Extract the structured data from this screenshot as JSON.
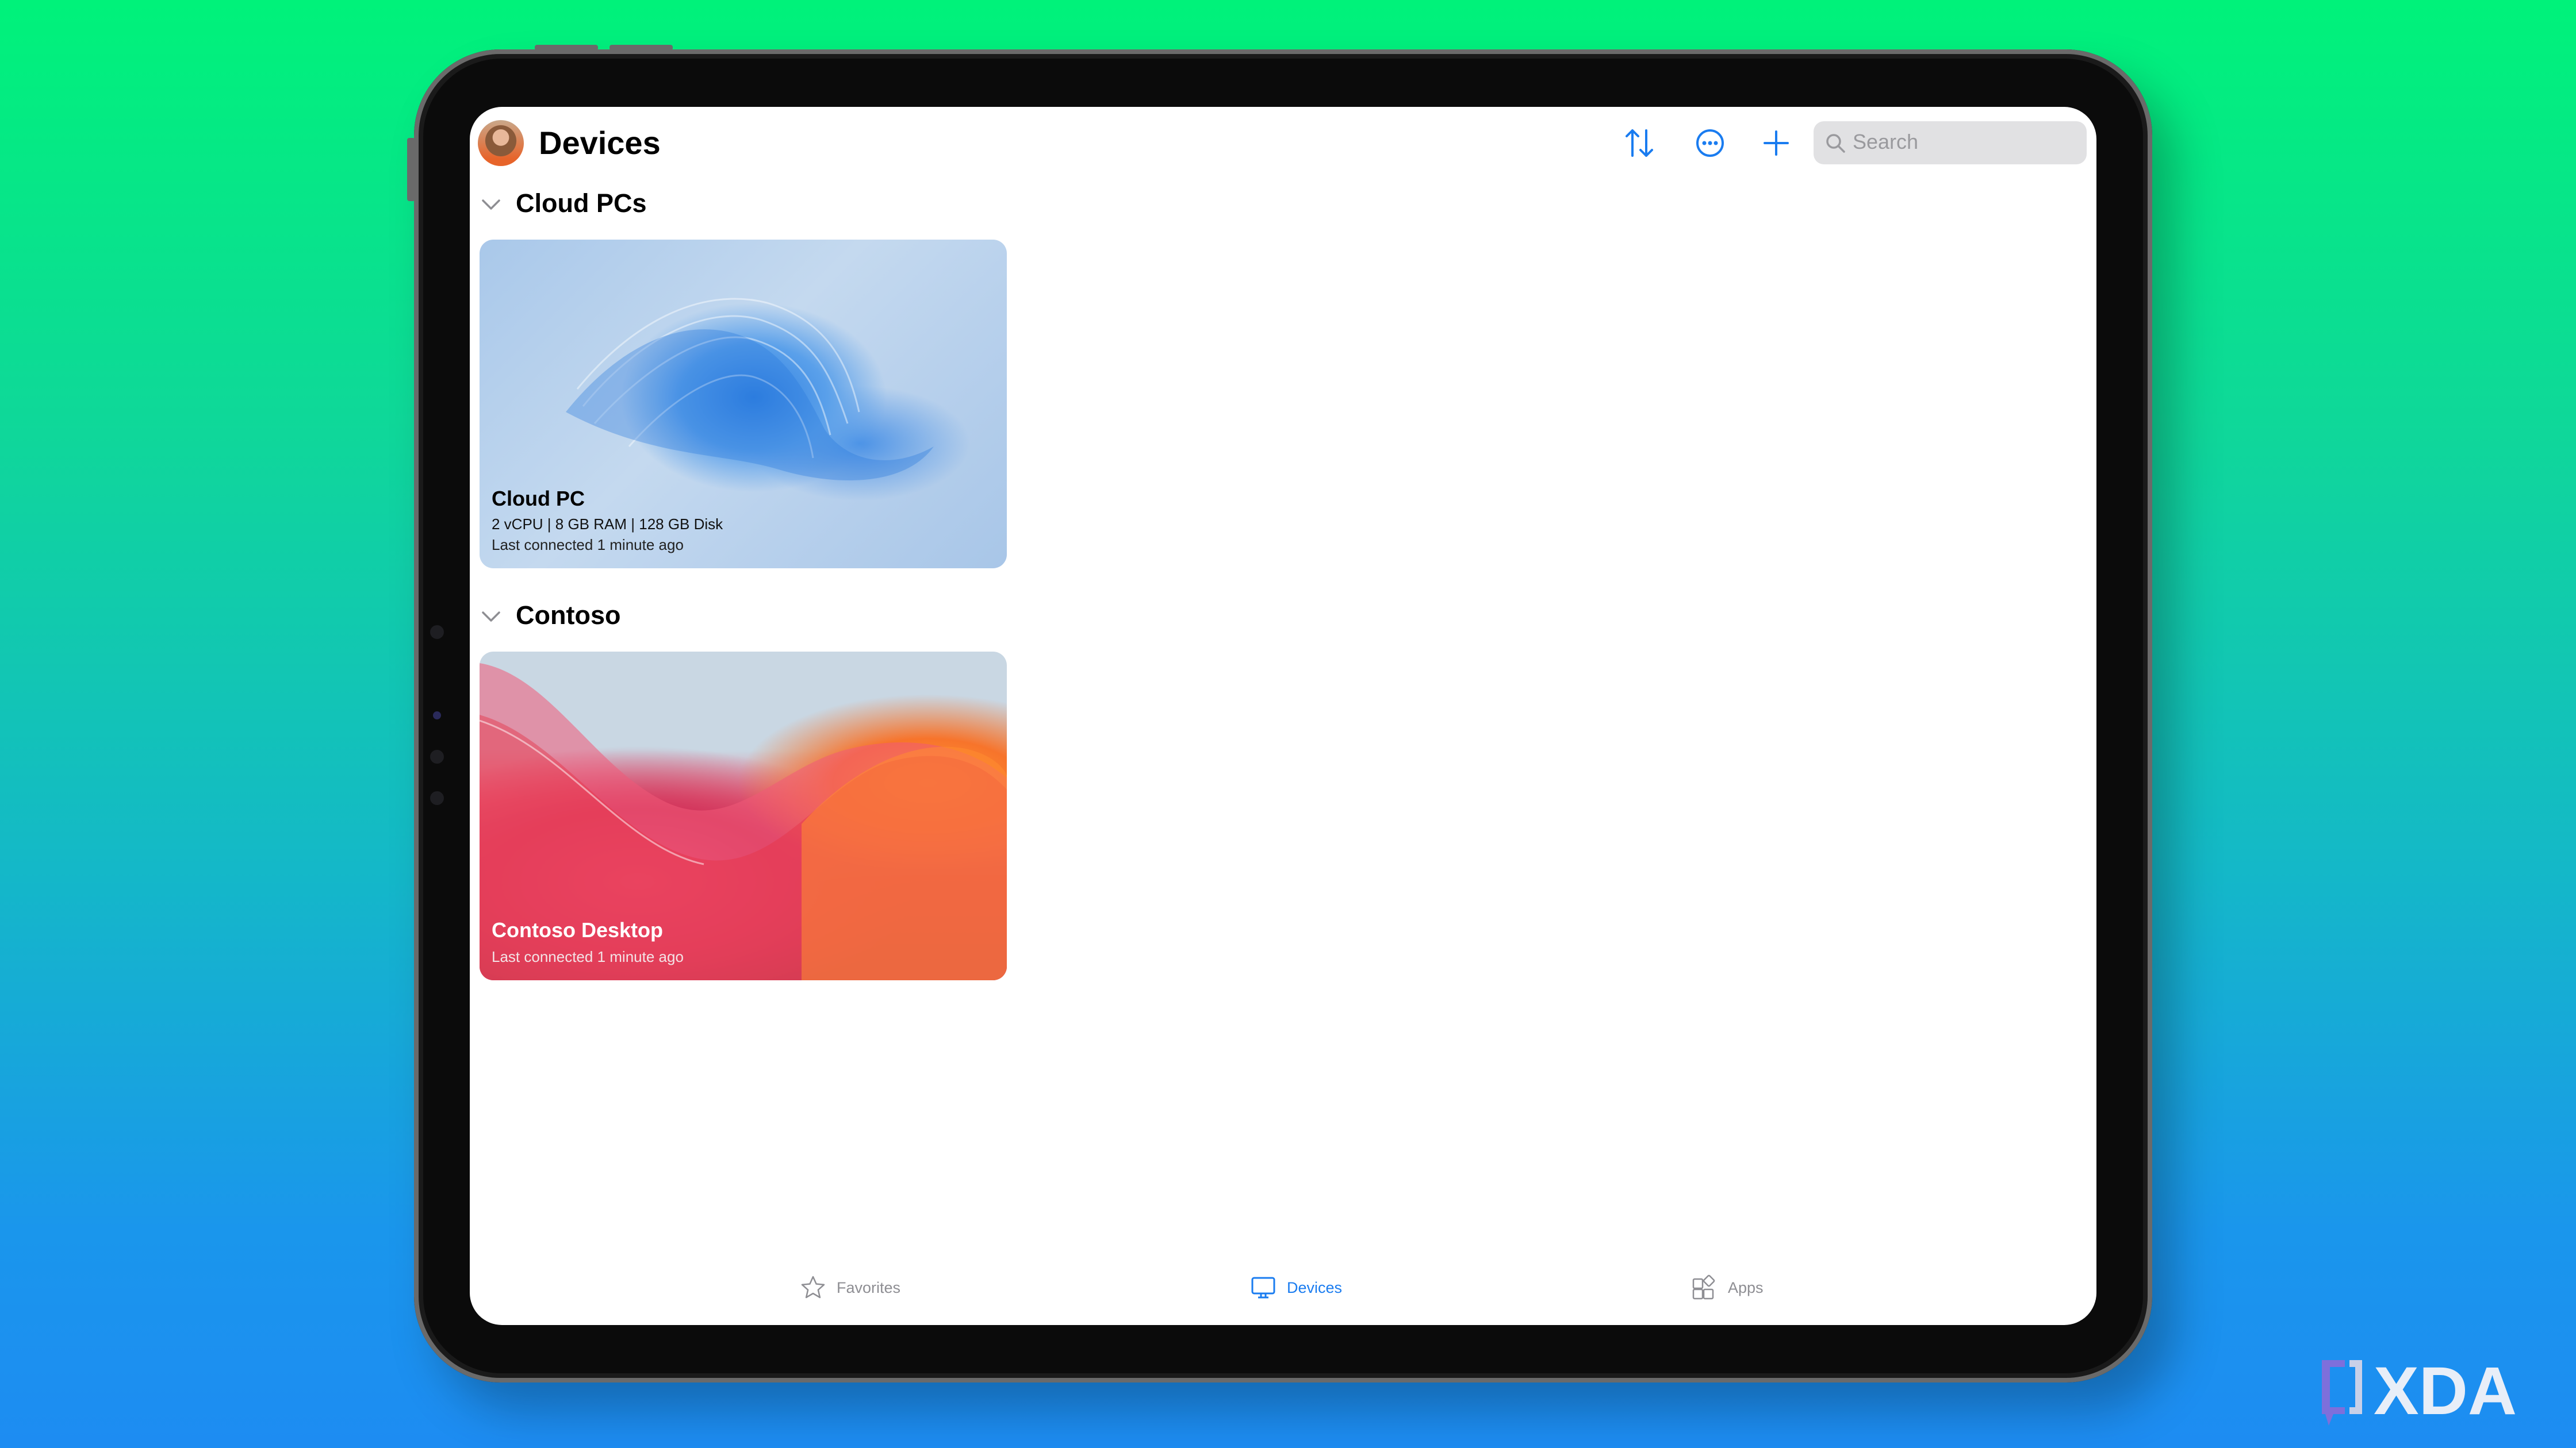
{
  "header": {
    "title": "Devices",
    "avatar": "user-avatar"
  },
  "toolbar": {
    "icons": [
      "sort-icon",
      "more-icon",
      "add-icon"
    ],
    "search_placeholder": "Search"
  },
  "sections": [
    {
      "title": "Cloud PCs",
      "expanded": true,
      "devices": [
        {
          "name": "Cloud PC",
          "specs": "2 vCPU | 8 GB RAM | 128 GB Disk",
          "status": "Last connected 1 minute ago"
        }
      ]
    },
    {
      "title": "Contoso",
      "expanded": true,
      "devices": [
        {
          "name": "Contoso Desktop",
          "status": "Last connected 1 minute ago"
        }
      ]
    }
  ],
  "tabs": [
    {
      "label": "Favorites",
      "icon": "star-icon",
      "active": false
    },
    {
      "label": "Devices",
      "icon": "monitor-icon",
      "active": true
    },
    {
      "label": "Apps",
      "icon": "apps-icon",
      "active": false
    }
  ],
  "colors": {
    "accent": "#1a7cf0",
    "inactive": "#8e8e93"
  },
  "watermark": "XDA"
}
